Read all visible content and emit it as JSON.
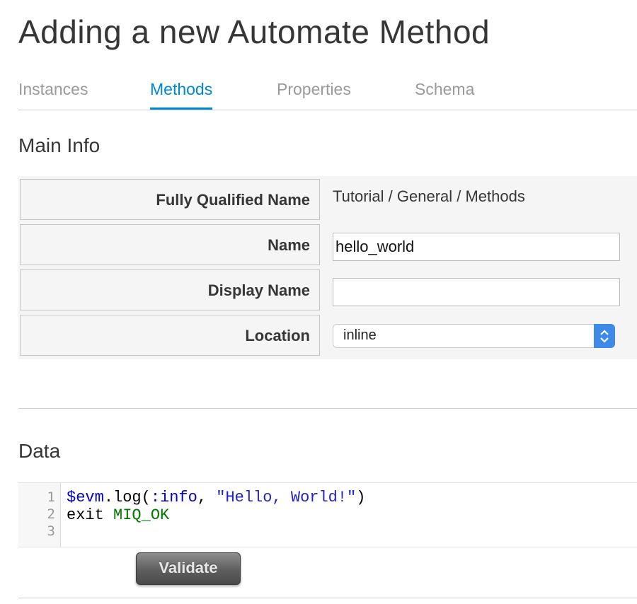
{
  "page": {
    "title": "Adding a new Automate Method"
  },
  "tabs": [
    {
      "label": "Instances",
      "active": false
    },
    {
      "label": "Methods",
      "active": true
    },
    {
      "label": "Properties",
      "active": false
    },
    {
      "label": "Schema",
      "active": false
    }
  ],
  "main_info": {
    "title": "Main Info",
    "fields": {
      "fqn": {
        "label": "Fully Qualified Name",
        "value": "Tutorial / General / Methods"
      },
      "name": {
        "label": "Name",
        "value": "hello_world",
        "placeholder": ""
      },
      "display_name": {
        "label": "Display Name",
        "value": "",
        "placeholder": ""
      },
      "location": {
        "label": "Location",
        "value": "inline",
        "options": [
          "inline"
        ]
      }
    }
  },
  "data_section": {
    "title": "Data",
    "line_numbers": [
      "1",
      "2",
      "3"
    ],
    "code": {
      "line1": {
        "var": "$evm",
        "call": ".log(",
        "sym": ":info",
        "sep": ", ",
        "str": "\"Hello, World!\"",
        "close": ")"
      },
      "line2": {
        "kw": "exit ",
        "const": "MIQ_OK"
      },
      "line3": ""
    }
  },
  "buttons": {
    "validate": "Validate"
  },
  "colors": {
    "accent": "#0088ce",
    "select_arrow": "#3d8ae8",
    "constant": "#007700"
  },
  "icons": {
    "select_arrow": "chevron-up-down-icon"
  }
}
